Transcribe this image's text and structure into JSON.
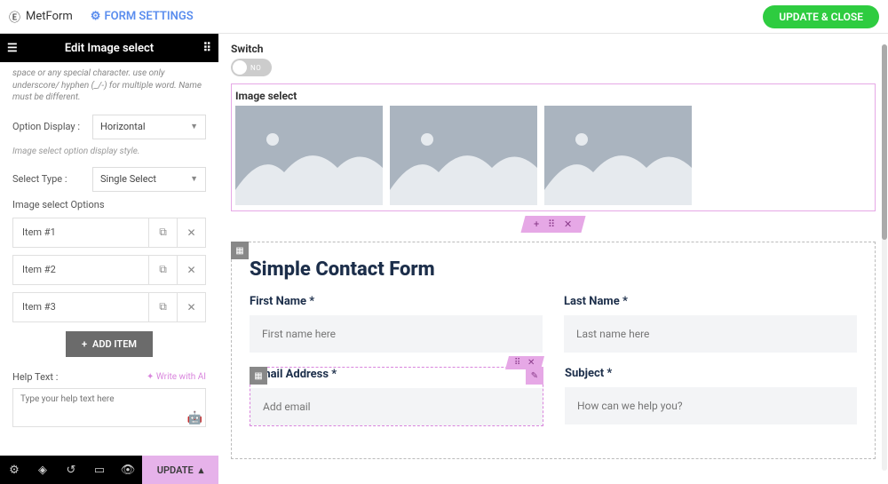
{
  "topbar": {
    "product": "MetForm",
    "settings": "FORM SETTINGS",
    "update_close": "UPDATE & CLOSE"
  },
  "panel": {
    "title": "Edit Image select",
    "name_hint": "space or any special character. use only underscore/ hyphen (_/-) for multiple word. Name must be different.",
    "option_display_label": "Option Display :",
    "option_display_value": "Horizontal",
    "option_display_hint": "Image select option display style.",
    "select_type_label": "Select Type :",
    "select_type_value": "Single Select",
    "options_label": "Image select Options",
    "items": [
      {
        "label": "Item #1"
      },
      {
        "label": "Item #2"
      },
      {
        "label": "Item #3"
      }
    ],
    "add_item": "ADD ITEM",
    "help_text_label": "Help Text :",
    "write_ai": "✦ Write with AI",
    "help_placeholder": "Type your help text here"
  },
  "bottom": {
    "update": "UPDATE"
  },
  "canvas": {
    "switch_label": "Switch",
    "switch_no": "NO",
    "image_select_label": "Image select",
    "sect_add": "+",
    "sect_drag": "⠿",
    "sect_close": "✕",
    "form": {
      "title": "Simple Contact Form",
      "first_name_label": "First Name *",
      "first_name_ph": "First name here",
      "last_name_label": "Last Name *",
      "last_name_ph": "Last name here",
      "email_label": "Email Address *",
      "email_ph": "Add email",
      "subject_label": "Subject *",
      "subject_ph": "How can we help you?"
    }
  }
}
